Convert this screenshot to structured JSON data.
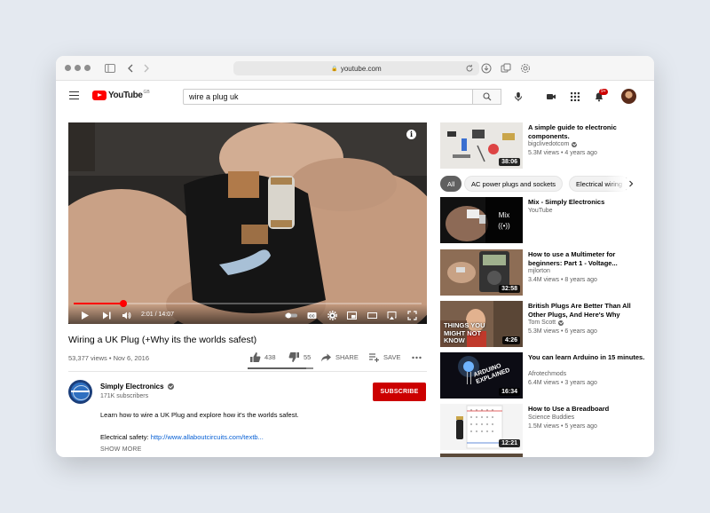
{
  "browser": {
    "url": "youtube.com"
  },
  "header": {
    "logo_text": "YouTube",
    "country_code": "GB",
    "search_value": "wire a plug uk",
    "notification_count": "9+"
  },
  "player": {
    "current_time": "2:01",
    "duration": "14:07",
    "time_display": "2:01 / 14:07",
    "progress_fraction": 0.143
  },
  "video": {
    "title": "Wiring a UK Plug (+Why its the worlds safest)",
    "stats": "53,377 views • Nov 6, 2016",
    "likes": "438",
    "dislikes": "55",
    "share_label": "SHARE",
    "save_label": "SAVE",
    "like_ratio": 0.888
  },
  "channel": {
    "name": "Simply Electronics",
    "subscribers": "171K subscribers",
    "subscribe_label": "SUBSCRIBE"
  },
  "description": {
    "line1": "Learn how to wire a UK Plug and explore how it's the worlds safest.",
    "line2_prefix": "Electrical safety: ",
    "line2_link": "http://www.allaboutcircuits.com/textb...",
    "show_more": "SHOW MORE"
  },
  "chips": [
    "All",
    "AC power plugs and sockets",
    "Electrical wiring"
  ],
  "sidebar": {
    "recommendations": [
      {
        "title": "A simple guide to electronic components.",
        "channel": "bigclivedotcom",
        "verified": true,
        "meta": "5.3M views • 4 years ago",
        "duration": "38:06"
      },
      {
        "title": "Mix - Simply Electronics",
        "channel": "YouTube",
        "verified": false,
        "meta": "",
        "duration": "",
        "mix_label": "Mix"
      },
      {
        "title": "How to use a Multimeter for beginners: Part 1 - Voltage...",
        "channel": "mjlorton",
        "verified": false,
        "meta": "3.4M views • 8 years ago",
        "duration": "32:58"
      },
      {
        "title": "British Plugs Are Better Than All Other Plugs, And Here's Why",
        "channel": "Tom Scott",
        "verified": true,
        "meta": "5.3M views • 6 years ago",
        "duration": "4:26",
        "thumb_text": "THINGS YOU MIGHT NOT KNOW"
      },
      {
        "title": "You can learn Arduino in 15 minutes.",
        "channel": "Afrotechmods",
        "verified": false,
        "meta": "6.4M views • 3 years ago",
        "duration": "16:34",
        "thumb_text": "ARDUINO EXPLAINED"
      },
      {
        "title": "How to Use a Breadboard",
        "channel": "Science Buddies",
        "verified": false,
        "meta": "1.5M views • 5 years ago",
        "duration": "12:21"
      }
    ]
  },
  "colors": {
    "brand_red": "#ff0000",
    "subscribe_red": "#cc0000",
    "link_blue": "#065fd4"
  }
}
